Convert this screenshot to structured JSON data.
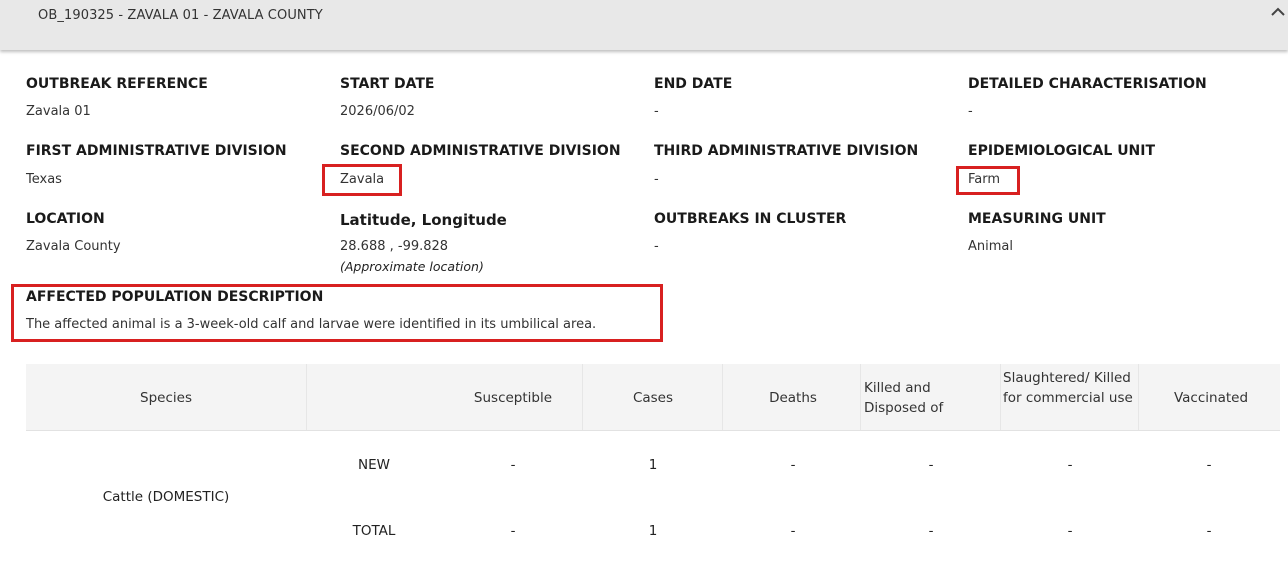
{
  "header": {
    "title": "OB_190325 - ZAVALA 01 - ZAVALA COUNTY",
    "toggle_icon": "chevron-up-icon"
  },
  "fields": {
    "outbreak_reference": {
      "label": "OUTBREAK REFERENCE",
      "value": "Zavala 01"
    },
    "start_date": {
      "label": "START DATE",
      "value": "2026/06/02"
    },
    "end_date": {
      "label": "END DATE",
      "value": "-"
    },
    "detailed_characterisation": {
      "label": "DETAILED CHARACTERISATION",
      "value": "-"
    },
    "first_admin_division": {
      "label": "FIRST ADMINISTRATIVE DIVISION",
      "value": "Texas"
    },
    "second_admin_division": {
      "label": "SECOND ADMINISTRATIVE DIVISION",
      "value": "Zavala"
    },
    "third_admin_division": {
      "label": "THIRD ADMINISTRATIVE DIVISION",
      "value": "-"
    },
    "epidemiological_unit": {
      "label": "EPIDEMIOLOGICAL UNIT",
      "value": "Farm"
    },
    "location": {
      "label": "LOCATION",
      "value": "Zavala County"
    },
    "lat_lon": {
      "label": "Latitude, Longitude",
      "value": "28.688 , -99.828",
      "note": "(Approximate location)"
    },
    "outbreaks_in_cluster": {
      "label": "OUTBREAKS IN CLUSTER",
      "value": "-"
    },
    "measuring_unit": {
      "label": "MEASURING UNIT",
      "value": "Animal"
    },
    "affected_population": {
      "label": "AFFECTED POPULATION DESCRIPTION",
      "value": "The affected animal is a 3-week-old calf and larvae were identified in its umbilical area."
    }
  },
  "highlight_color": "#d82020",
  "table": {
    "headers": {
      "species": "Species",
      "susceptible": "Susceptible",
      "cases": "Cases",
      "deaths": "Deaths",
      "killed_disposed": "Killed and Disposed of",
      "slaughtered": "Slaughtered/ Killed for commercial use",
      "vaccinated": "Vaccinated"
    },
    "species_name": "Cattle (DOMESTIC)",
    "rows": [
      {
        "type": "NEW",
        "susceptible": "-",
        "cases": "1",
        "deaths": "-",
        "killed_disposed": "-",
        "slaughtered": "-",
        "vaccinated": "-"
      },
      {
        "type": "TOTAL",
        "susceptible": "-",
        "cases": "1",
        "deaths": "-",
        "killed_disposed": "-",
        "slaughtered": "-",
        "vaccinated": "-"
      }
    ]
  }
}
